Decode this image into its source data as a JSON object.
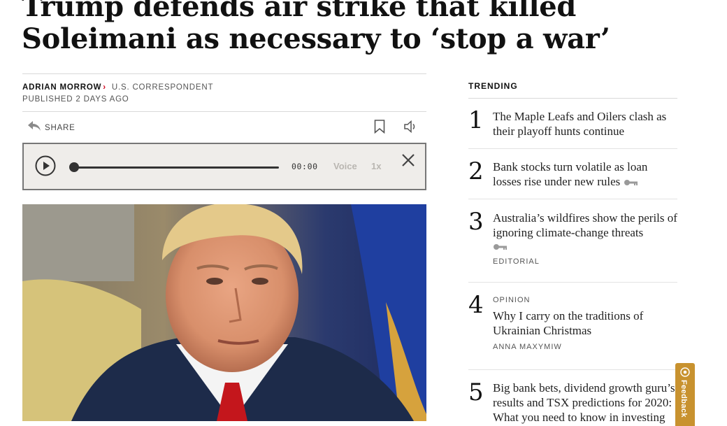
{
  "article": {
    "headline": "Trump defends air strike that killed Soleimani as necessary to ‘stop a war’",
    "author": "ADRIAN MORROW",
    "role": "U.S. CORRESPONDENT",
    "published": "PUBLISHED 2 DAYS AGO"
  },
  "toolbar": {
    "share_label": "SHARE"
  },
  "player": {
    "time": "00:00",
    "voice_label": "Voice",
    "speed_label": "1x",
    "progress": 0
  },
  "trending": {
    "title": "TRENDING",
    "items": [
      {
        "num": "1",
        "headline": "The Maple Leafs and Oilers clash as their playoff hunts continue"
      },
      {
        "num": "2",
        "headline": "Bank stocks turn volatile as loan losses rise under new rules"
      },
      {
        "num": "3",
        "headline": "Australia’s wildfires show the perils of ignoring climate-change threats",
        "tag_below": "EDITORIAL"
      },
      {
        "num": "4",
        "tag_above": "OPINION",
        "headline": "Why I carry on the traditions of Ukrainian Christmas",
        "tag_below": "ANNA MAXYMIW"
      },
      {
        "num": "5",
        "headline": "Big bank bets, dividend growth guru’s results and TSX predictions for 2020: What you need to know in investing"
      }
    ]
  },
  "feedback": {
    "label": "Feedback"
  },
  "colors": {
    "accent_red": "#d0021b",
    "feedback_bg": "#c8922f",
    "player_bg": "#efedea"
  },
  "icons": [
    "share-arrow-icon",
    "bookmark-icon",
    "speaker-icon",
    "play-icon",
    "close-icon",
    "key-icon",
    "feedback-icon"
  ]
}
